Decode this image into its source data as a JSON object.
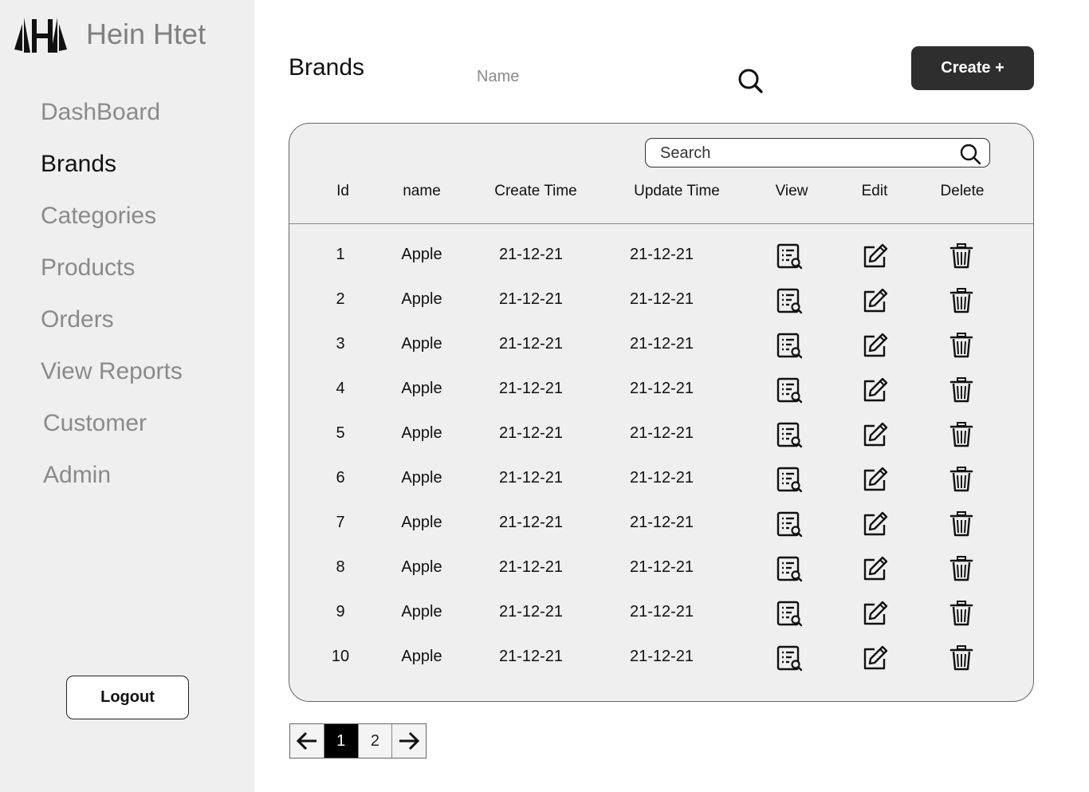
{
  "sidebar": {
    "brand_name": "Hein Htet",
    "nav": [
      {
        "label": "DashBoard",
        "active": false
      },
      {
        "label": "Brands",
        "active": true
      },
      {
        "label": "Categories",
        "active": false
      },
      {
        "label": "Products",
        "active": false
      },
      {
        "label": "Orders",
        "active": false
      },
      {
        "label": "View Reports",
        "active": false
      },
      {
        "label": "Customer",
        "active": false
      },
      {
        "label": "Admin",
        "active": false
      }
    ],
    "logout_label": "Logout"
  },
  "header": {
    "title": "Brands",
    "name_placeholder": "Name",
    "create_label": "Create +"
  },
  "table": {
    "search_placeholder": "Search",
    "columns": [
      "Id",
      "name",
      "Create Time",
      "Update Time",
      "View",
      "Edit",
      "Delete"
    ],
    "rows": [
      {
        "id": "1",
        "name": "Apple",
        "create_time": "21-12-21",
        "update_time": "21-12-21"
      },
      {
        "id": "2",
        "name": "Apple",
        "create_time": "21-12-21",
        "update_time": "21-12-21"
      },
      {
        "id": "3",
        "name": "Apple",
        "create_time": "21-12-21",
        "update_time": "21-12-21"
      },
      {
        "id": "4",
        "name": "Apple",
        "create_time": "21-12-21",
        "update_time": "21-12-21"
      },
      {
        "id": "5",
        "name": "Apple",
        "create_time": "21-12-21",
        "update_time": "21-12-21"
      },
      {
        "id": "6",
        "name": "Apple",
        "create_time": "21-12-21",
        "update_time": "21-12-21"
      },
      {
        "id": "7",
        "name": "Apple",
        "create_time": "21-12-21",
        "update_time": "21-12-21"
      },
      {
        "id": "8",
        "name": "Apple",
        "create_time": "21-12-21",
        "update_time": "21-12-21"
      },
      {
        "id": "9",
        "name": "Apple",
        "create_time": "21-12-21",
        "update_time": "21-12-21"
      },
      {
        "id": "10",
        "name": "Apple",
        "create_time": "21-12-21",
        "update_time": "21-12-21"
      }
    ],
    "row_icons": {
      "view": "view-details-icon",
      "edit": "edit-icon",
      "delete": "trash-icon"
    }
  },
  "pagination": {
    "pages": [
      "1",
      "2"
    ],
    "current": "1",
    "prev_icon": "arrow-left-icon",
    "next_icon": "arrow-right-icon"
  },
  "colors": {
    "sidebar_bg": "#efefef",
    "card_bg": "#efefef",
    "primary_button": "#2e2e2e",
    "nav_inactive": "#8a8a8a",
    "nav_active": "#111111"
  }
}
